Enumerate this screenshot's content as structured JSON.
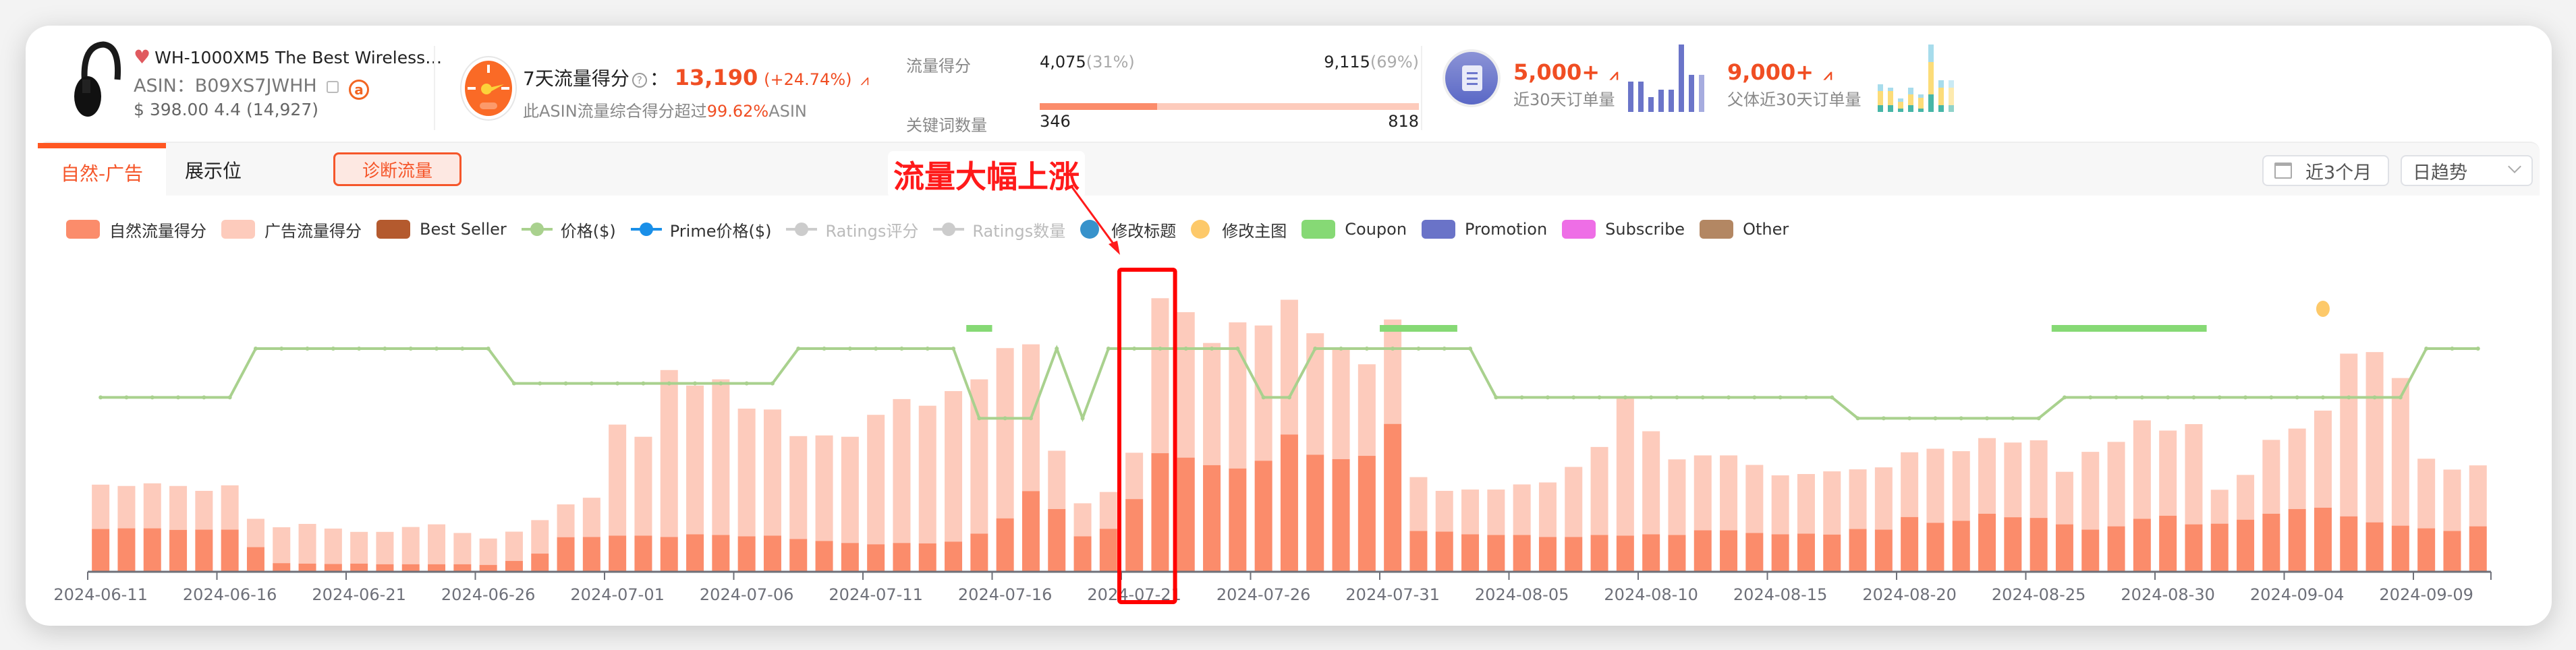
{
  "product": {
    "title": "WH-1000XM5 The Best Wireless…",
    "asin_label": "ASIN：",
    "asin": "B09XS7JWHH",
    "price": "$ 398.00",
    "rating": "4.4",
    "reviews": "(14,927)",
    "favorite_icon": "heart-icon",
    "amazon_icon": "amazon-icon"
  },
  "traffic": {
    "label": "7天流量得分",
    "colon": "：",
    "value": "13,190",
    "change": "(+24.74%)",
    "sub_prefix": "此ASIN流量综合得分超过",
    "sub_highlight": "99.62%",
    "sub_suffix": "ASIN"
  },
  "split": {
    "score_label": "流量得分",
    "organic_value": "4,075",
    "organic_pct": "(31%)",
    "ad_value": "9,115",
    "ad_pct": "(69%)",
    "organic_share": 0.31,
    "keyword_label": "关键词数量",
    "organic_keywords": "346",
    "ad_keywords": "818"
  },
  "orders": {
    "value": "5,000+",
    "label": "近30天订单量",
    "parent_value": "9,000+",
    "parent_label": "父体近30天订单量",
    "mini_bars": [
      0.45,
      0.45,
      0.22,
      0.33,
      0.33,
      1.0,
      0.55,
      0.55
    ],
    "mini_stacked": [
      [
        0.1,
        0.21,
        0.1
      ],
      [
        0.1,
        0.21,
        0.05
      ],
      [
        0.05,
        0.1,
        0.05
      ],
      [
        0.1,
        0.16,
        0.1
      ],
      [
        0.05,
        0.16,
        0.05
      ],
      [
        0.26,
        0.48,
        0.26
      ],
      [
        0.1,
        0.26,
        0.11
      ],
      [
        0.1,
        0.26,
        0.11
      ]
    ],
    "colors": {
      "bar": "#6b75c9",
      "teal": "#47b6a7",
      "yellow": "#fcdc78",
      "blue": "#a7dcec"
    }
  },
  "tabs": [
    {
      "label": "自然-广告",
      "active": true
    },
    {
      "label": "展示位",
      "active": false
    }
  ],
  "diagnose_button": "诊断流量",
  "annotation": "流量大幅上涨",
  "controls": {
    "range": "近3个月",
    "granularity": "日趋势"
  },
  "legend": [
    {
      "label": "自然流量得分",
      "type": "rect",
      "color": "#fb8c6b",
      "enabled": true
    },
    {
      "label": "广告流量得分",
      "type": "rect",
      "color": "#fdcbbc",
      "enabled": true
    },
    {
      "label": "Best Seller",
      "type": "rect",
      "color": "#b45a2e",
      "enabled": true
    },
    {
      "label": "价格($)",
      "type": "line",
      "color": "#a9d18e",
      "enabled": true
    },
    {
      "label": "Prime价格($)",
      "type": "line",
      "color": "#1a8fe8",
      "enabled": true
    },
    {
      "label": "Ratings评分",
      "type": "line",
      "color": "#cccccc",
      "enabled": false
    },
    {
      "label": "Ratings数量",
      "type": "line",
      "color": "#cccccc",
      "enabled": false
    },
    {
      "label": "修改标题",
      "type": "dot",
      "color": "#3792cb",
      "enabled": true
    },
    {
      "label": "修改主图",
      "type": "dot",
      "color": "#fdc96a",
      "enabled": true
    },
    {
      "label": "Coupon",
      "type": "rect",
      "color": "#86d975",
      "enabled": true
    },
    {
      "label": "Promotion",
      "type": "rect",
      "color": "#6a73c8",
      "enabled": true
    },
    {
      "label": "Subscribe",
      "type": "rect",
      "color": "#ee6ee6",
      "enabled": true
    },
    {
      "label": "Other",
      "type": "rect",
      "color": "#b38763",
      "enabled": true
    }
  ],
  "chart_data": {
    "type": "bar",
    "stacked": true,
    "title": "",
    "xlabel": "",
    "ylabel": "",
    "ylim": [
      0,
      2500
    ],
    "price_ylim": [
      200,
      450
    ],
    "grid": false,
    "legend_position": "top-left",
    "x_tick_labels": [
      "2024-06-11",
      "2024-06-16",
      "2024-06-21",
      "2024-06-26",
      "2024-07-01",
      "2024-07-06",
      "2024-07-11",
      "2024-07-16",
      "2024-07-21",
      "2024-07-26",
      "2024-07-31",
      "2024-08-05",
      "2024-08-10",
      "2024-08-15",
      "2024-08-20",
      "2024-08-25",
      "2024-08-30",
      "2024-09-04",
      "2024-09-09"
    ],
    "start_date": "2024-06-11",
    "categories_count": 93,
    "series": [
      {
        "name": "自然流量得分",
        "color": "#fb8c6b",
        "values": [
          386,
          392,
          392,
          378,
          380,
          380,
          222,
          78,
          74,
          70,
          74,
          68,
          68,
          68,
          68,
          62,
          98,
          164,
          312,
          314,
          326,
          326,
          314,
          338,
          332,
          320,
          326,
          296,
          278,
          260,
          248,
          260,
          256,
          272,
          344,
          482,
          728,
          566,
          320,
          388,
          656,
          1070,
          1030,
          962,
          932,
          1002,
          1238,
          1056,
          1016,
          1046,
          1334,
          368,
          362,
          338,
          332,
          332,
          314,
          314,
          332,
          326,
          338,
          332,
          374,
          374,
          350,
          338,
          344,
          336,
          386,
          380,
          494,
          442,
          460,
          524,
          492,
          486,
          428,
          380,
          410,
          478,
          506,
          428,
          434,
          470,
          524,
          566,
          578,
          500,
          446,
          416,
          392,
          368,
          410
        ]
      },
      {
        "name": "广告流量得分",
        "color": "#fdcbbc",
        "values": [
          400,
          382,
          406,
          396,
          350,
          400,
          256,
          324,
          358,
          320,
          286,
          292,
          336,
          360,
          282,
          238,
          264,
          302,
          296,
          354,
          1002,
          892,
          1506,
          1342,
          1404,
          1152,
          1138,
          928,
          952,
          958,
          1168,
          1298,
          1242,
          1358,
          1392,
          1536,
          1324,
          526,
          298,
          332,
          418,
          1398,
          1312,
          1102,
          1318,
          1220,
          1216,
          1096,
          996,
          826,
          942,
          486,
          368,
          404,
          410,
          456,
          492,
          632,
          794,
          1248,
          930,
          682,
          676,
          676,
          614,
          532,
          538,
          570,
          538,
          562,
          584,
          668,
          628,
          682,
          674,
          700,
          474,
          702,
          762,
          888,
          768,
          904,
          306,
          404,
          666,
          726,
          876,
          1468,
          1536,
          1332,
          628,
          554,
          550
        ]
      },
      {
        "name": "价格($)",
        "type": "line",
        "color": "#a9d18e",
        "values": [
          328,
          328,
          328,
          328,
          328,
          328,
          398,
          398,
          398,
          398,
          398,
          398,
          398,
          398,
          398,
          398,
          348,
          348,
          348,
          348,
          348,
          348,
          348,
          348,
          348,
          348,
          348,
          398,
          398,
          398,
          398,
          398,
          398,
          398,
          298,
          298,
          298,
          398,
          298,
          398,
          398,
          398,
          398,
          398,
          398,
          328,
          328,
          398,
          398,
          398,
          398,
          398,
          398,
          398,
          328,
          328,
          328,
          328,
          328,
          328,
          328,
          328,
          328,
          328,
          328,
          328,
          328,
          328,
          298,
          298,
          298,
          298,
          298,
          298,
          298,
          298,
          328,
          328,
          328,
          328,
          328,
          328,
          328,
          328,
          328,
          328,
          328,
          328,
          328,
          328,
          398,
          398,
          398
        ]
      }
    ],
    "coupon_ranges": [
      [
        "2024-07-15",
        "2024-07-15"
      ],
      [
        "2024-07-31",
        "2024-08-02"
      ],
      [
        "2024-08-26",
        "2024-08-31"
      ]
    ],
    "events": [
      {
        "type": "修改主图",
        "date": "2024-09-05"
      }
    ],
    "highlight_box": {
      "from": "2024-07-21",
      "to": "2024-07-22",
      "color": "#ff0000"
    }
  }
}
